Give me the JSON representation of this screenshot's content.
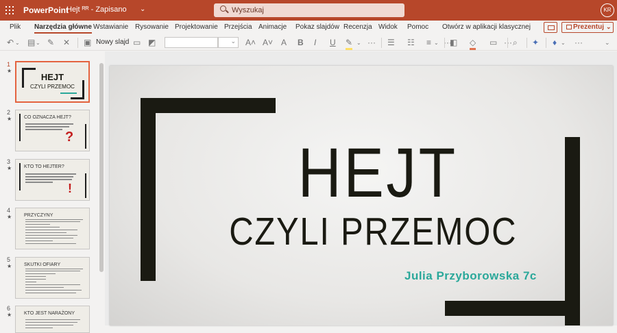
{
  "titlebar": {
    "app_name": "PowerPoint",
    "doc_name": "Hejt ᴿᴿ - Zapisano",
    "search_placeholder": "Wyszukaj",
    "avatar_initials": "KR",
    "bg_color": "#b7472a"
  },
  "tabs": [
    {
      "label": "Plik",
      "active": false
    },
    {
      "label": "Narzędzia główne",
      "active": true
    },
    {
      "label": "Wstawianie",
      "active": false
    },
    {
      "label": "Rysowanie",
      "active": false
    },
    {
      "label": "Projektowanie",
      "active": false
    },
    {
      "label": "Przejścia",
      "active": false
    },
    {
      "label": "Animacje",
      "active": false
    },
    {
      "label": "Pokaz slajdów",
      "active": false
    },
    {
      "label": "Recenzja",
      "active": false
    },
    {
      "label": "Widok",
      "active": false
    },
    {
      "label": "Pomoc",
      "active": false
    },
    {
      "label": "Otwórz w aplikacji klasycznej",
      "active": false
    }
  ],
  "present_button": {
    "label": "Prezentuj"
  },
  "ribbon": {
    "new_slide_label": "Nowy slajd"
  },
  "thumbnails": [
    {
      "number": "1",
      "title": "",
      "selected": true
    },
    {
      "number": "2",
      "title": "CO OZNACZA HEJT?",
      "selected": false
    },
    {
      "number": "3",
      "title": "KTO TO HEJTER?",
      "selected": false
    },
    {
      "number": "4",
      "title": "PRZYCZYNY",
      "selected": false
    },
    {
      "number": "5",
      "title": "SKUTKI OFIARY",
      "selected": false
    },
    {
      "number": "6",
      "title": "KTO JEST NARAŻONY",
      "selected": false
    }
  ],
  "thumb1": {
    "title": "HEJT",
    "subtitle": "CZYLI PRZEMOC"
  },
  "slide": {
    "title": "HEJT",
    "subtitle": "CZYLI PRZEMOC",
    "author": "Julia Przyborowska 7c",
    "author_color": "#2aa89a"
  }
}
